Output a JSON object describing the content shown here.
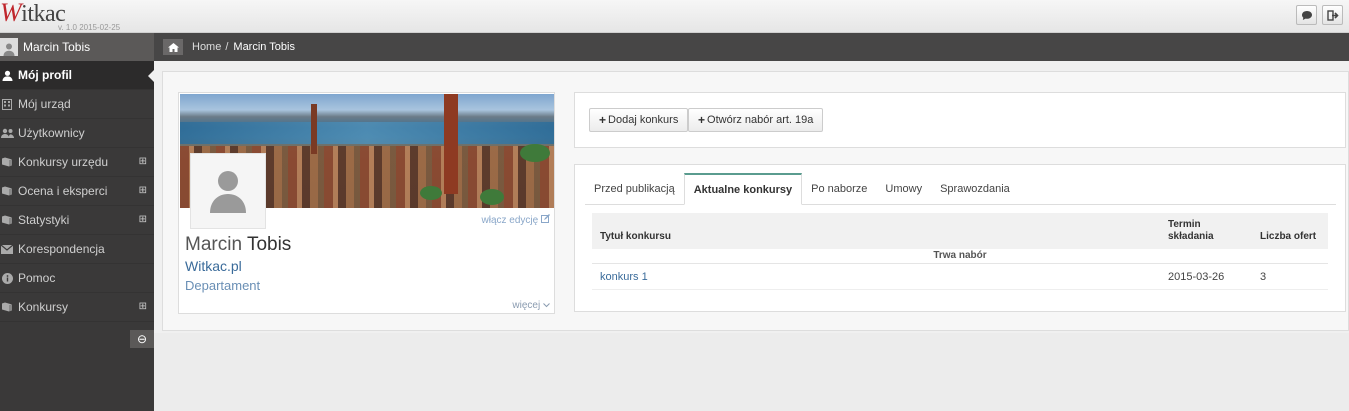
{
  "app": {
    "logo_text": "itkac",
    "logo_initial": "W",
    "version": "v. 1.0 2015-02-25"
  },
  "topbar": {
    "chat_icon": "chat-bubble-icon",
    "logout_icon": "logout-icon"
  },
  "sidebar": {
    "user_name": "Marcin Tobis",
    "items": [
      {
        "label": "Mój profil",
        "icon": "user-icon",
        "active": true,
        "expandable": false
      },
      {
        "label": "Mój urząd",
        "icon": "building-icon",
        "expandable": false
      },
      {
        "label": "Użytkownicy",
        "icon": "users-icon",
        "expandable": false
      },
      {
        "label": "Konkursy urzędu",
        "icon": "book-icon",
        "expandable": true
      },
      {
        "label": "Ocena i eksperci",
        "icon": "book-icon",
        "expandable": true
      },
      {
        "label": "Statystyki",
        "icon": "book-icon",
        "expandable": true
      },
      {
        "label": "Korespondencja",
        "icon": "envelope-icon",
        "expandable": false
      },
      {
        "label": "Pomoc",
        "icon": "info-icon",
        "expandable": false
      },
      {
        "label": "Konkursy",
        "icon": "book-icon",
        "expandable": true
      }
    ],
    "expand_glyph": "⊞",
    "collapse_glyph": "⊖"
  },
  "breadcrumb": {
    "home": "Home",
    "separator": "/",
    "current": "Marcin Tobis"
  },
  "profile": {
    "first_name": "Marcin",
    "last_name": "Tobis",
    "organization": "Witkac.pl",
    "department": "Departament",
    "edit_link": "włącz edycję",
    "more_link": "więcej"
  },
  "actions": {
    "add_contest": "Dodaj konkurs",
    "open_call": "Otwórz nabór art. 19a"
  },
  "tabs": [
    {
      "label": "Przed publikacją",
      "active": false
    },
    {
      "label": "Aktualne konkursy",
      "active": true
    },
    {
      "label": "Po naborze",
      "active": false
    },
    {
      "label": "Umowy",
      "active": false
    },
    {
      "label": "Sprawozdania",
      "active": false
    }
  ],
  "table": {
    "columns": {
      "title": "Tytuł konkursu",
      "deadline_line1": "Termin",
      "deadline_line2": "składania",
      "offers": "Liczba ofert"
    },
    "group": "Trwa nabór",
    "rows": [
      {
        "title": "konkurs 1",
        "deadline": "2015-03-26",
        "offers": "3"
      }
    ]
  },
  "colors": {
    "sidebar_bg": "#3a3939",
    "active_tab_accent": "#5a9c8f",
    "link": "#3a6b9a",
    "logo_accent": "#c0272d"
  }
}
